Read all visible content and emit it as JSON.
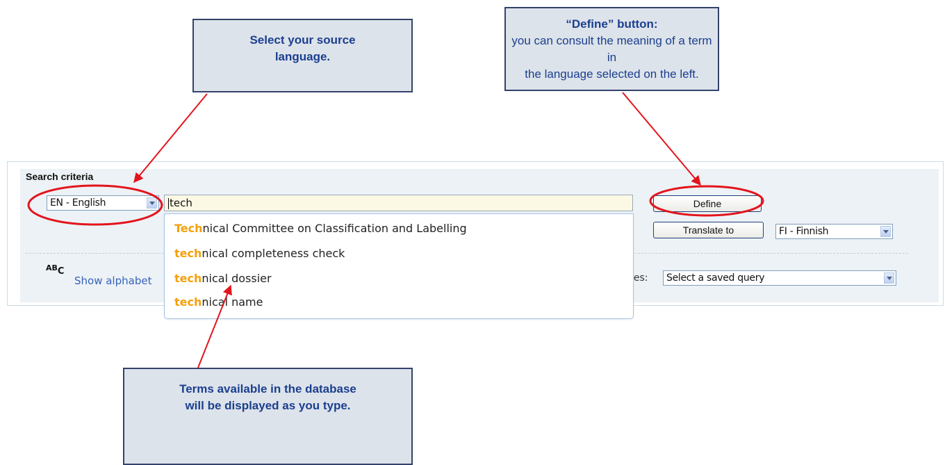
{
  "callouts": {
    "source": {
      "line1": "Select your source",
      "line2": "language."
    },
    "define": {
      "title": "“Define” button:",
      "line1": "you can consult the meaning of a term in",
      "line2": "the language selected on the left."
    },
    "terms": {
      "line1": "Terms available in the database",
      "line2": "will be displayed as you type."
    }
  },
  "panel": {
    "title": "Search criteria"
  },
  "source_language": {
    "selected": "EN - English"
  },
  "search": {
    "value": "tech"
  },
  "buttons": {
    "define": "Define",
    "translate_to": "Translate to"
  },
  "target_language": {
    "selected": "FI - Finnish"
  },
  "suggestions": [
    {
      "match": "Tech",
      "rest": "nical Committee on Classification and Labelling"
    },
    {
      "match": "tech",
      "rest": "nical completeness check"
    },
    {
      "match": "tech",
      "rest": "nical dossier"
    },
    {
      "match": "tech",
      "rest": "nical name"
    }
  ],
  "alphabet": {
    "icon_top": "AB",
    "icon_bottom": "C",
    "link": "Show alphabet"
  },
  "saved_queries": {
    "label": "ies:",
    "selected": "Select a saved query"
  },
  "colors": {
    "callout_fill": "#dde3ea",
    "callout_border": "#33426b",
    "callout_text": "#1b3f8f",
    "annotation_red": "#e3141c",
    "highlight_orange": "#f5a00a"
  }
}
